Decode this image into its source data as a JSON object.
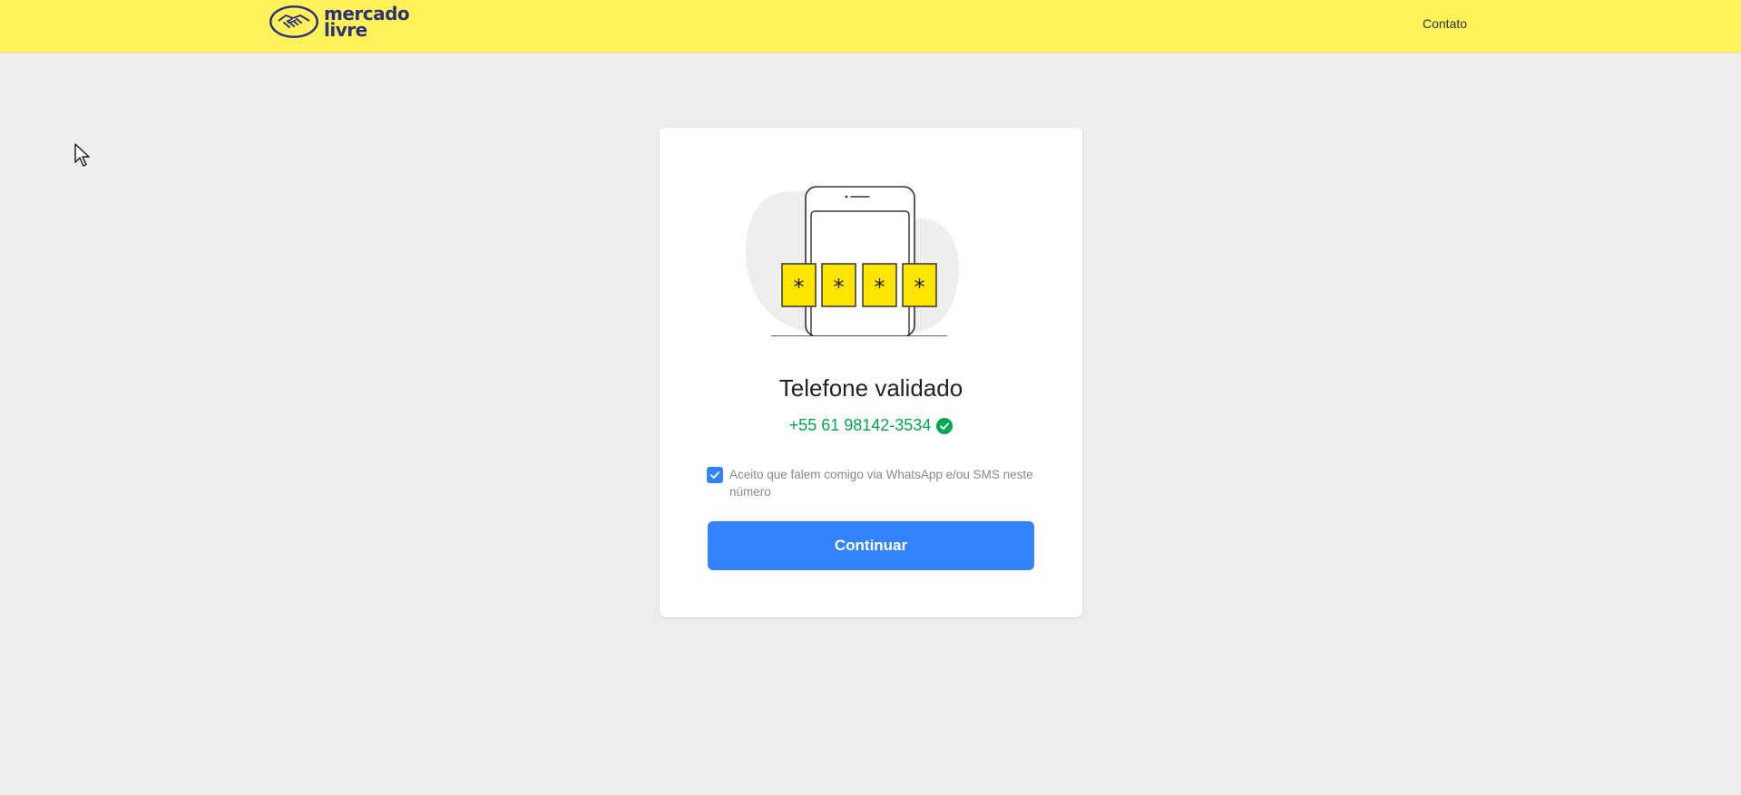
{
  "header": {
    "logo_line1": "mercado",
    "logo_line2": "livre",
    "contact_label": "Contato",
    "background_color": "#fff159"
  },
  "card": {
    "illustration_digits": [
      "*",
      "*",
      "*",
      "*"
    ],
    "title": "Telefone validado",
    "phone_number": "+55 61 98142-3534",
    "consent_checked": true,
    "consent_text": "Aceito que falem comigo via WhatsApp e/ou SMS neste número",
    "continue_label": "Continuar"
  },
  "colors": {
    "accent": "#3483fa",
    "success": "#00a650",
    "page_background": "#ededed"
  },
  "icons": {
    "logo": "handshake-logo-icon",
    "verified": "check-circle-icon",
    "checkbox": "checkmark-icon",
    "cursor": "mouse-pointer-icon"
  }
}
